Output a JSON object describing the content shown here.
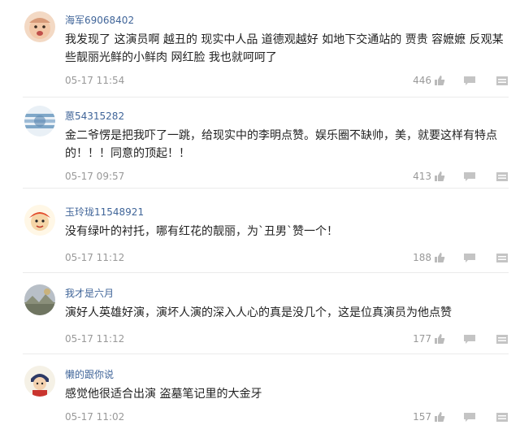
{
  "comments": [
    {
      "user": "海军69068402",
      "text": "我发现了 这演员啊 越丑的 现实中人品 道德观越好 如地下交通站的 贾贵 容嬷嬷 反观某些靓丽光鲜的小鲜肉 网红脸 我也就呵呵了",
      "time": "05-17 11:54",
      "likes": "446",
      "avatar_icon": "baby-face-avatar-icon",
      "avatar_colors": [
        "#f3c8a8",
        "#d89a78"
      ]
    },
    {
      "user": "蒽54315282",
      "text": "金二爷愣是把我吓了一跳，给现实中的李明点赞。娱乐圈不缺帅，美，就要这样有特点的！！！同意的顶起！！",
      "time": "05-17 09:57",
      "likes": "413",
      "avatar_icon": "blue-pattern-avatar-icon",
      "avatar_colors": [
        "#d7e6f3",
        "#7fa7c8"
      ]
    },
    {
      "user": "玉玲珑11548921",
      "text": "没有绿叶的衬托，哪有红花的靓丽，为`丑男`赞一个！",
      "time": "05-17 11:12",
      "likes": "188",
      "avatar_icon": "monkey-king-avatar-icon",
      "avatar_colors": [
        "#fff2d6",
        "#e24b2a"
      ]
    },
    {
      "user": "我才是六月",
      "text": "演好人英雄好演，演坏人演的深入人心的真是没几个，这是位真演员为他点赞",
      "time": "05-17 11:12",
      "likes": "177",
      "avatar_icon": "landscape-avatar-icon",
      "avatar_colors": [
        "#8a8f7a",
        "#c9b27c"
      ]
    },
    {
      "user": "懒的跟你说",
      "text": "感觉他很适合出演 盗墓笔记里的大金牙",
      "time": "05-17 11:02",
      "likes": "157",
      "avatar_icon": "cartoon-person-avatar-icon",
      "avatar_colors": [
        "#f5f1e6",
        "#2d3a66"
      ]
    }
  ]
}
